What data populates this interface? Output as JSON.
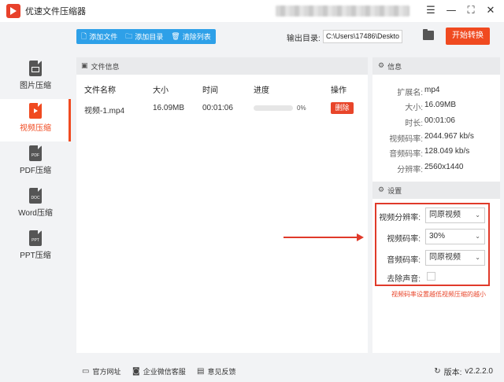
{
  "app": {
    "title": "优速文件压缩器"
  },
  "window": {
    "menu_icon": "menu-icon",
    "minimize_glyph": "—",
    "maximize_glyph": "⛶",
    "close_glyph": "✕"
  },
  "toolbar": {
    "add_file": "添加文件",
    "add_dir": "添加目录",
    "clear_list": "清除列表",
    "output_label": "输出目录:",
    "output_path": "C:\\Users\\17486\\Deskto",
    "start": "开始转换"
  },
  "sidebar": {
    "items": [
      {
        "label": "图片压缩",
        "icon": "image-file-icon"
      },
      {
        "label": "视频压缩",
        "icon": "video-file-icon",
        "active": true
      },
      {
        "label": "PDF压缩",
        "icon": "pdf-file-icon",
        "badge": "PDF"
      },
      {
        "label": "Word压缩",
        "icon": "doc-file-icon",
        "badge": "DOC"
      },
      {
        "label": "PPT压缩",
        "icon": "ppt-file-icon",
        "badge": "PPT"
      }
    ]
  },
  "file_panel": {
    "heading": "文件信息",
    "columns": {
      "name": "文件名称",
      "size": "大小",
      "time": "时间",
      "progress": "进度",
      "action": "操作"
    },
    "rows": [
      {
        "name": "视频-1.mp4",
        "size": "16.09MB",
        "time": "00:01:06",
        "progress_pct": "0%",
        "progress_value": 0,
        "delete": "删除"
      }
    ]
  },
  "info_panel": {
    "heading": "信息",
    "rows": [
      {
        "key": "扩展名:",
        "value": "mp4"
      },
      {
        "key": "大小:",
        "value": "16.09MB"
      },
      {
        "key": "时长:",
        "value": "00:01:06"
      },
      {
        "key": "视频码率:",
        "value": "2044.967 kb/s"
      },
      {
        "key": "音频码率:",
        "value": "128.049 kb/s"
      },
      {
        "key": "分辨率:",
        "value": "2560x1440"
      }
    ]
  },
  "settings": {
    "heading": "设置",
    "video_resolution_label": "视频分辨率:",
    "video_resolution_value": "同原视频",
    "video_bitrate_label": "视频码率:",
    "video_bitrate_value": "30%",
    "audio_bitrate_label": "音频码率:",
    "audio_bitrate_value": "同原视频",
    "mute_label": "去除声音:",
    "mute_checked": false,
    "hint": "视频码率设置越低视频压缩的越小"
  },
  "footer": {
    "website": "官方网址",
    "wechat": "企业微信客服",
    "feedback": "意见反馈",
    "version_label": "版本:",
    "version": "v2.2.2.0"
  },
  "colors": {
    "accent": "#f04a20",
    "primary": "#2ea0e8",
    "highlight_box": "#e03a2a"
  }
}
